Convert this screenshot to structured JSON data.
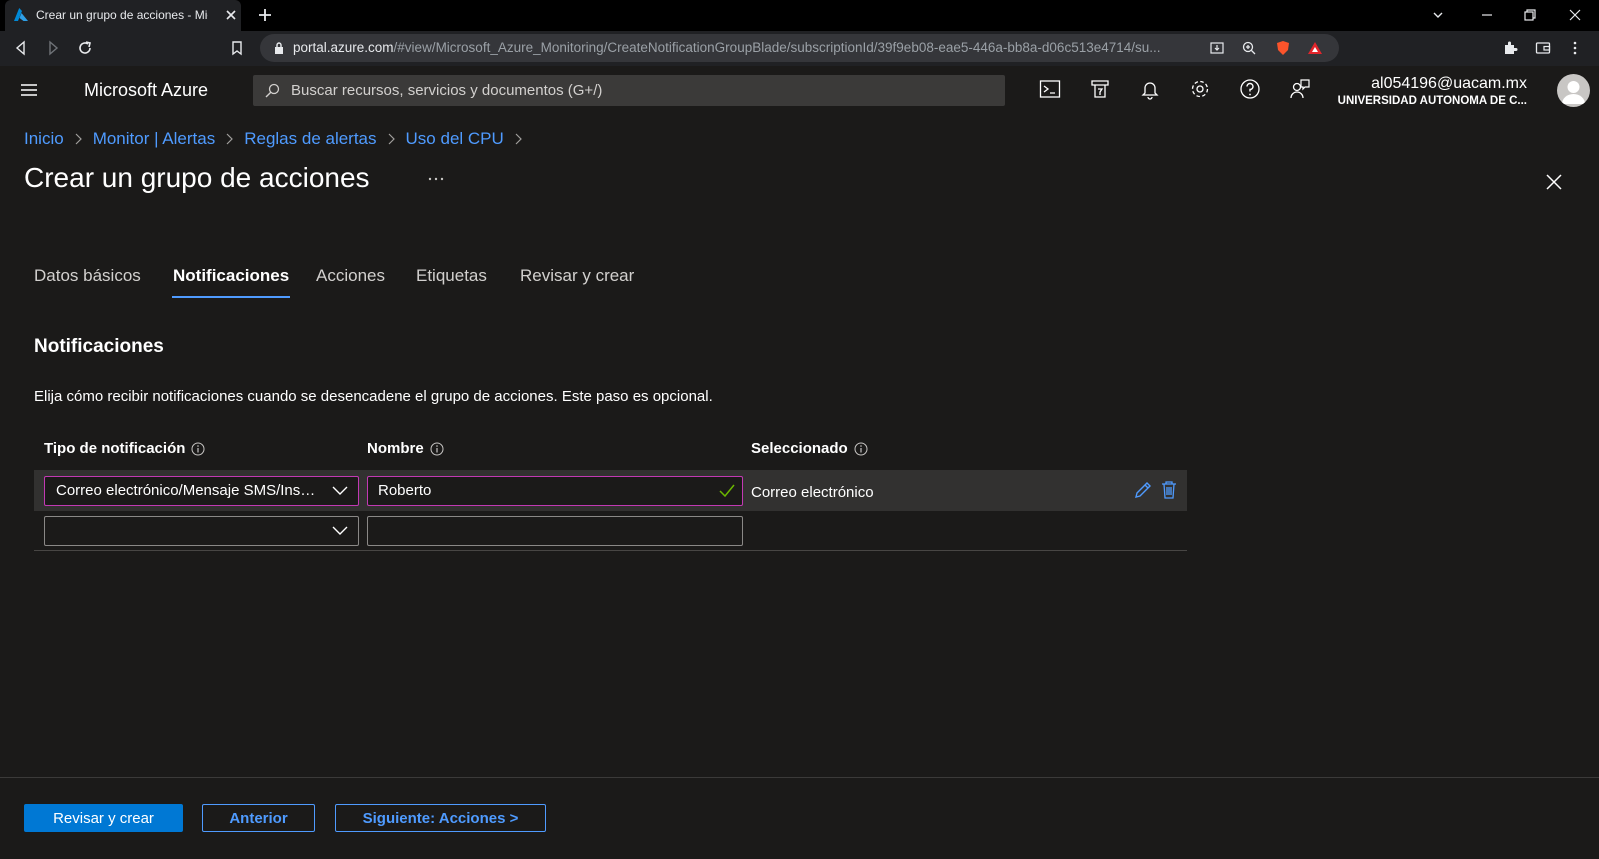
{
  "browser": {
    "tab_title": "Crear un grupo de acciones - Microsoft Azure",
    "url_host": "portal.azure.com",
    "url_path": "/#view/Microsoft_Azure_Monitoring/CreateNotificationGroupBlade/subscriptionId/39f9eb08-eae5-446a-bb8a-d06c513e4714/su..."
  },
  "header": {
    "brand": "Microsoft Azure",
    "search_placeholder": "Buscar recursos, servicios y documentos (G+/)",
    "user_email": "al054196@uacam.mx",
    "user_org": "UNIVERSIDAD AUTONOMA DE C...",
    "icons": [
      "cloud-shell-icon",
      "directory-filter-icon",
      "notifications-icon",
      "settings-icon",
      "help-icon",
      "feedback-icon"
    ]
  },
  "breadcrumb": [
    "Inicio",
    "Monitor | Alertas",
    "Reglas de alertas",
    "Uso del CPU"
  ],
  "page": {
    "title": "Crear un grupo de acciones",
    "more": "···"
  },
  "tabs": [
    "Datos básicos",
    "Notificaciones",
    "Acciones",
    "Etiquetas",
    "Revisar y crear"
  ],
  "active_tab": "Notificaciones",
  "section": {
    "title": "Notificaciones",
    "description": "Elija cómo recibir notificaciones cuando se desencadene el grupo de acciones. Este paso es opcional."
  },
  "table": {
    "headers": [
      "Tipo de notificación",
      "Nombre",
      "Seleccionado"
    ],
    "rows": [
      {
        "type": "Correo electrónico/Mensaje SMS/Insert/Voz",
        "name": "Roberto",
        "selected": "Correo electrónico"
      },
      {
        "type": "",
        "name": "",
        "selected": ""
      }
    ]
  },
  "footer": {
    "review_create": "Revisar y crear",
    "previous": "Anterior",
    "next": "Siguiente: Acciones >"
  },
  "colors": {
    "accent": "#0078d4",
    "link": "#4f9bff",
    "focus_border": "#c239b3",
    "valid_check": "#6bb700"
  }
}
